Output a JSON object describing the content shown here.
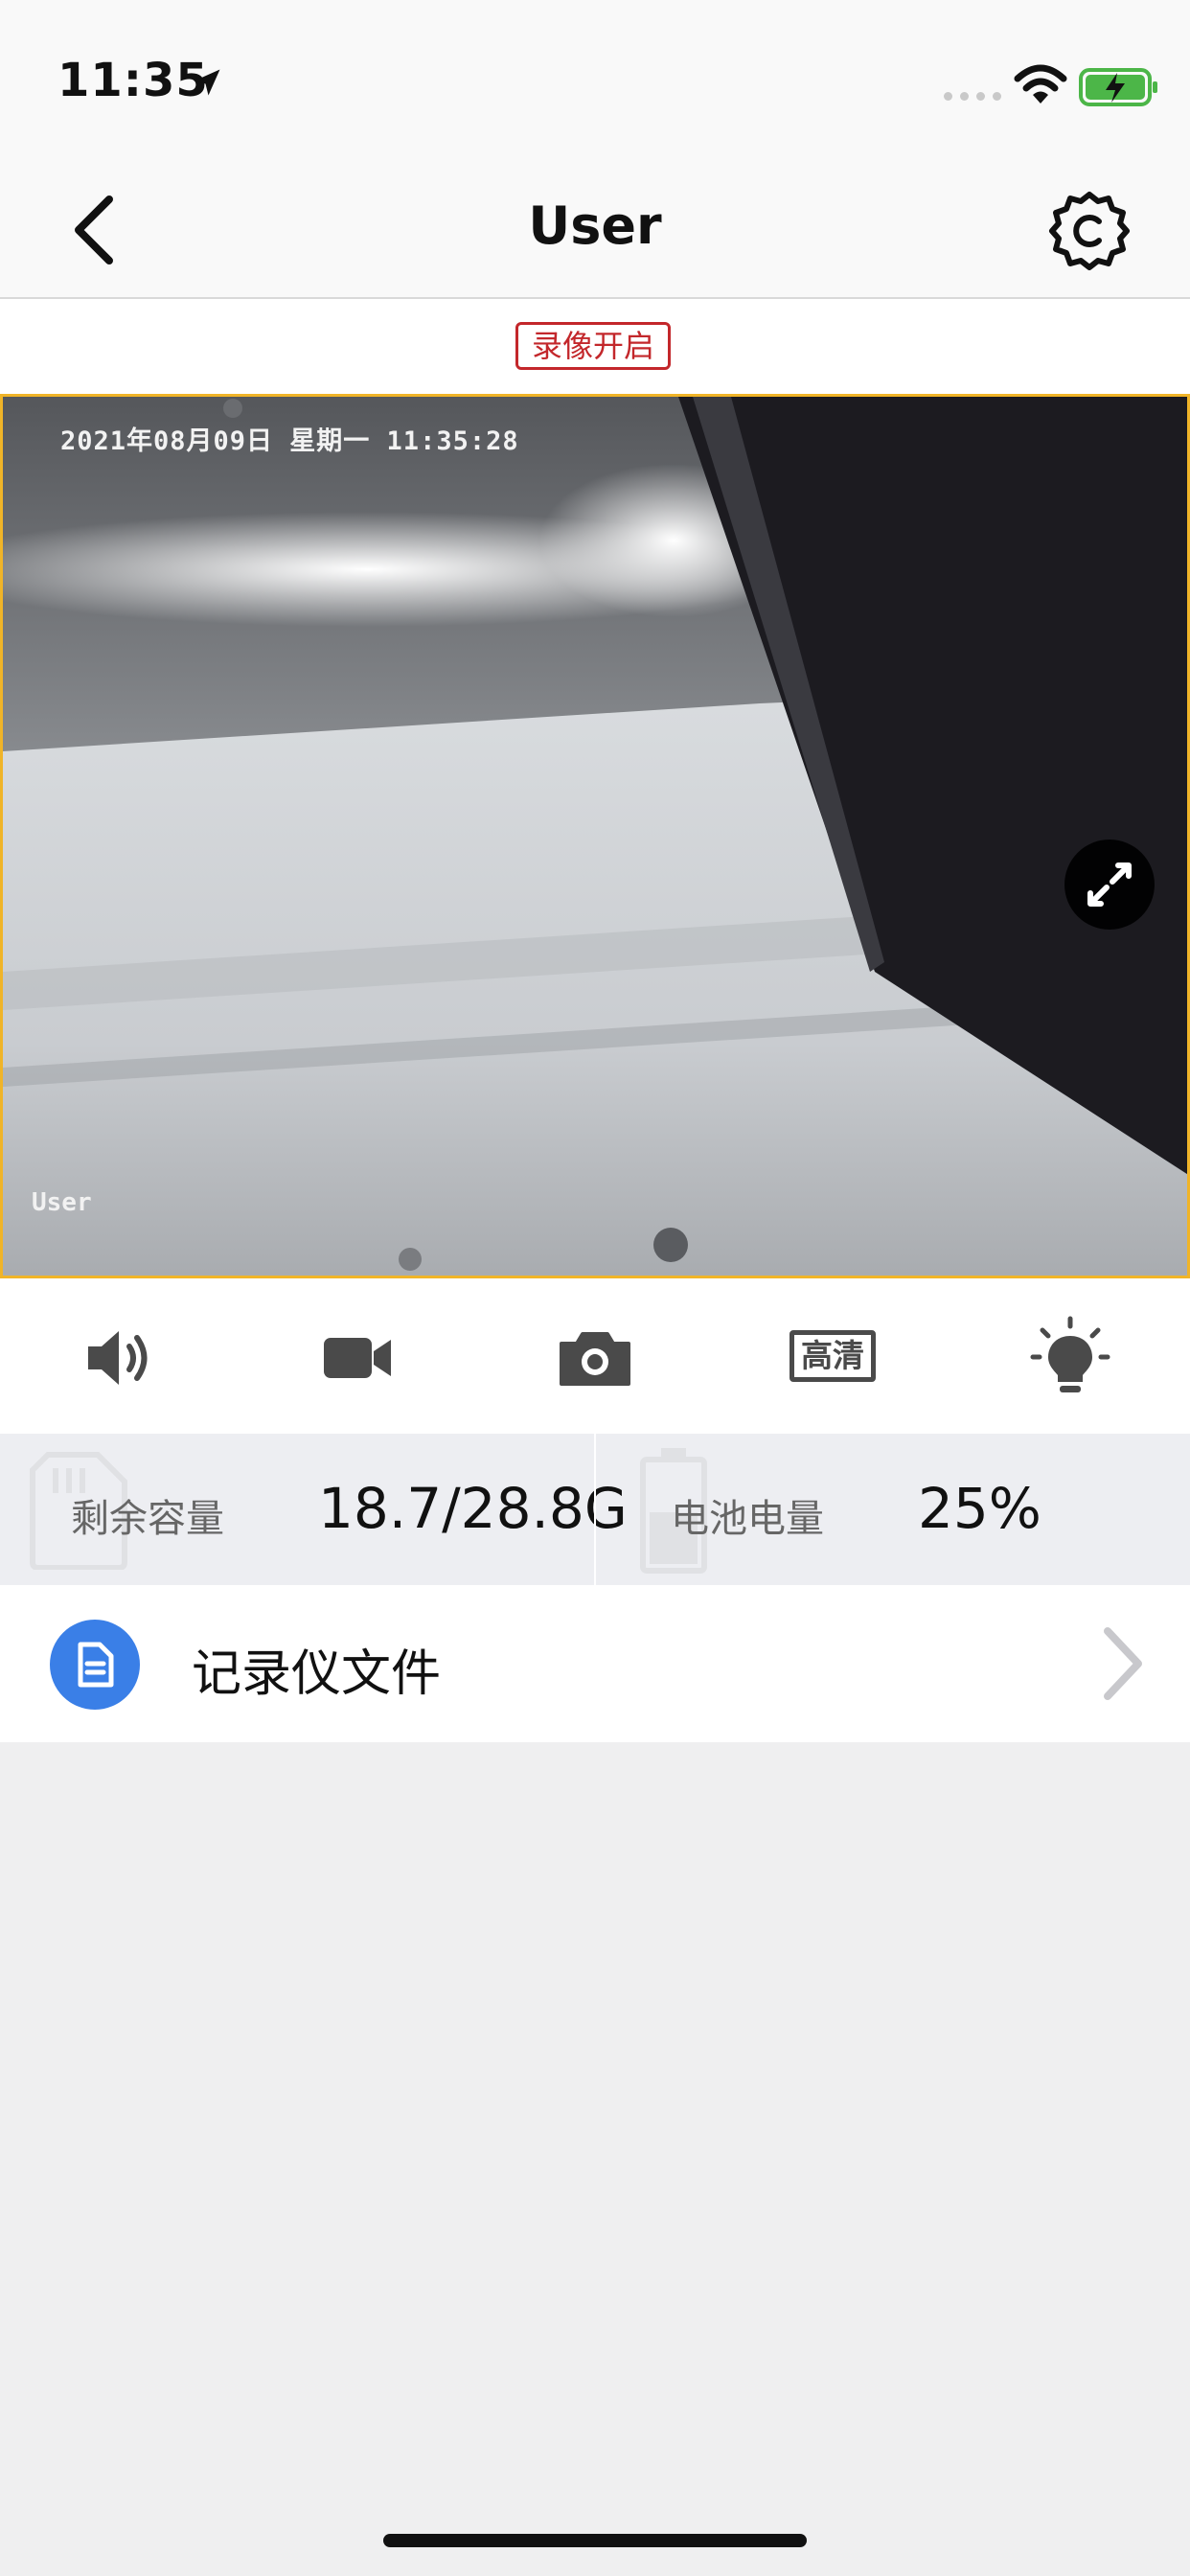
{
  "status_bar": {
    "time": "11:35"
  },
  "nav": {
    "title": "User"
  },
  "recording_badge": "录像开启",
  "video": {
    "timestamp": "2021年08月09日 星期一 11:35:28",
    "overlay_user": "User"
  },
  "controls": {
    "hd_label": "高清"
  },
  "storage": {
    "label": "剩余容量",
    "value": "18.7/28.8G"
  },
  "battery": {
    "label": "电池电量",
    "value": "25%"
  },
  "files": {
    "label": "记录仪文件"
  },
  "colors": {
    "accent_blue": "#3a7fe7",
    "record_red": "#c3272b",
    "video_border": "#f0b428"
  }
}
